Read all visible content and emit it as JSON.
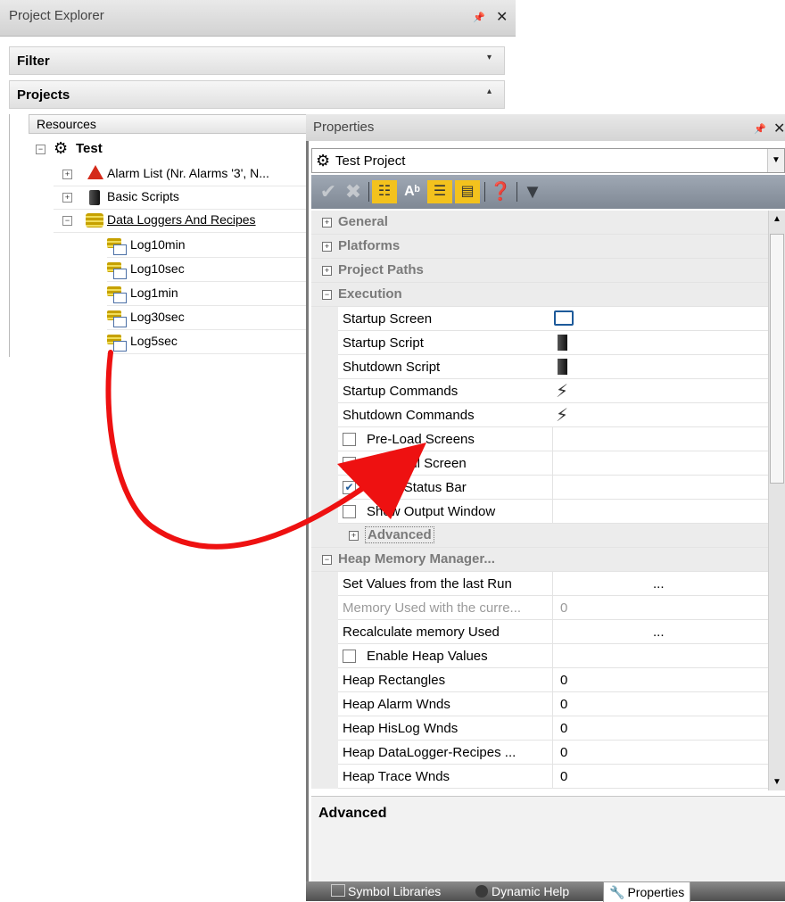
{
  "project_explorer": {
    "title": "Project Explorer",
    "filter_label": "Filter",
    "projects_label": "Projects",
    "resources_header": "Resources",
    "tree": {
      "root": "Test",
      "items": [
        {
          "label": "Alarm List (Nr. Alarms '3', N..."
        },
        {
          "label": "Basic Scripts"
        },
        {
          "label": "Data Loggers And Recipes"
        }
      ],
      "loggers": [
        "Log10min",
        "Log10sec",
        "Log1min",
        "Log30sec",
        "Log5sec"
      ]
    }
  },
  "properties": {
    "title": "Properties",
    "selected_object": "Test Project",
    "categories": {
      "general": "General",
      "platforms": "Platforms",
      "project_paths": "Project Paths",
      "execution": "Execution",
      "advanced": "Advanced",
      "heap": "Heap Memory Manager..."
    },
    "execution_rows": {
      "startup_screen": "Startup Screen",
      "startup_script": "Startup Script",
      "shutdown_script": "Shutdown Script",
      "startup_commands": "Startup Commands",
      "shutdown_commands": "Shutdown Commands"
    },
    "checkbox_rows": [
      {
        "label": "Pre-Load Screens",
        "checked": false
      },
      {
        "label": "Start Full Screen",
        "checked": false
      },
      {
        "label": "Show Status Bar",
        "checked": true
      },
      {
        "label": "Show Output Window",
        "checked": false
      }
    ],
    "heap_rows": {
      "set_values": {
        "label": "Set Values from the last Run",
        "value": "..."
      },
      "memory_used": {
        "label": "Memory Used with the curre...",
        "value": "0"
      },
      "recalculate": {
        "label": "Recalculate memory Used",
        "value": "..."
      },
      "enable_heap": {
        "label": "Enable Heap Values",
        "checked": false
      },
      "rectangles": {
        "label": "Heap Rectangles",
        "value": "0"
      },
      "alarm_wnds": {
        "label": "Heap Alarm Wnds",
        "value": "0"
      },
      "hislog_wnds": {
        "label": "Heap HisLog Wnds",
        "value": "0"
      },
      "datalogger": {
        "label": "Heap DataLogger-Recipes ...",
        "value": "0"
      },
      "trace_wnds": {
        "label": "Heap Trace Wnds",
        "value": "0"
      }
    },
    "description_title": "Advanced",
    "tabs": {
      "symbol_libraries": "Symbol Libraries",
      "dynamic_help": "Dynamic Help",
      "properties": "Properties"
    }
  },
  "colors": {
    "annotation_arrow": "#ee1111",
    "toolbar_bg": "#8f98a3",
    "category_bg": "#ececec"
  }
}
